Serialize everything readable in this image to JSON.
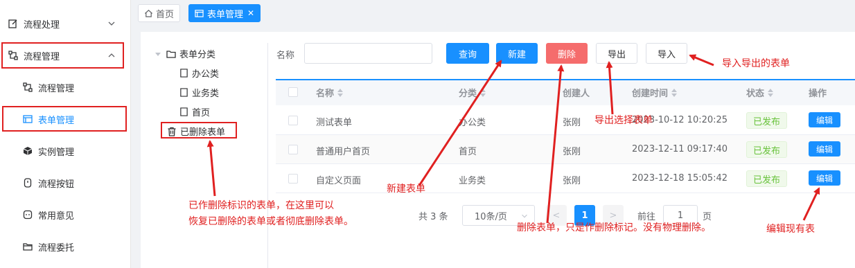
{
  "sidebar": {
    "items": [
      {
        "label": "流程处理",
        "icon": "edit-icon"
      },
      {
        "label": "流程管理",
        "icon": "flow-icon"
      }
    ],
    "sub_items": [
      {
        "label": "流程管理",
        "icon": "flow-icon"
      },
      {
        "label": "表单管理",
        "icon": "form-icon"
      },
      {
        "label": "实例管理",
        "icon": "cube-icon"
      },
      {
        "label": "流程按钮",
        "icon": "button-icon"
      },
      {
        "label": "常用意见",
        "icon": "comment-icon"
      },
      {
        "label": "流程委托",
        "icon": "folder-icon"
      }
    ]
  },
  "tabs": [
    {
      "label": "首页",
      "icon": "home-icon"
    },
    {
      "label": "表单管理",
      "icon": "form-icon",
      "close": "✕"
    }
  ],
  "tree": {
    "root": "表单分类",
    "children": [
      "办公类",
      "业务类",
      "首页"
    ],
    "deleted": "已删除表单"
  },
  "search": {
    "name_label": "名称",
    "name_value": "",
    "query": "查询",
    "create": "新建",
    "delete": "删除",
    "export": "导出",
    "import": "导入"
  },
  "table": {
    "headers": [
      "名称",
      "分类",
      "创建人",
      "创建时间",
      "状态",
      "操作"
    ],
    "rows": [
      {
        "name": "测试表单",
        "category": "办公类",
        "creator": "张刚",
        "time": "2023-10-12 10:20:25",
        "status": "已发布",
        "action": "编辑"
      },
      {
        "name": "普通用户首页",
        "category": "首页",
        "creator": "张刚",
        "time": "2023-12-11 09:17:40",
        "status": "已发布",
        "action": "编辑"
      },
      {
        "name": "自定义页面",
        "category": "业务类",
        "creator": "张刚",
        "time": "2023-12-18 15:05:42",
        "status": "已发布",
        "action": "编辑"
      }
    ]
  },
  "pagination": {
    "total": "共 3 条",
    "page_size": "10条/页",
    "prev": "<",
    "current": "1",
    "next": ">",
    "goto_label": "前往",
    "goto_value": "1",
    "page_suffix": "页"
  },
  "annotations": {
    "deleted_forms_1": "已作删除标识的表单，在这里可以",
    "deleted_forms_2": "恢复已删除的表单或者彻底删除表单。",
    "new_form": "新建表单",
    "delete_form": "删除表单，只是作删除标记。没有物理删除。",
    "export_selected": "导出选择表单",
    "import_export": "导入导出的表单",
    "edit_existing": "编辑现有表"
  },
  "colors": {
    "primary": "#1890ff",
    "danger": "#f56c6c",
    "success": "#67c23a",
    "annotation": "#e02020"
  }
}
